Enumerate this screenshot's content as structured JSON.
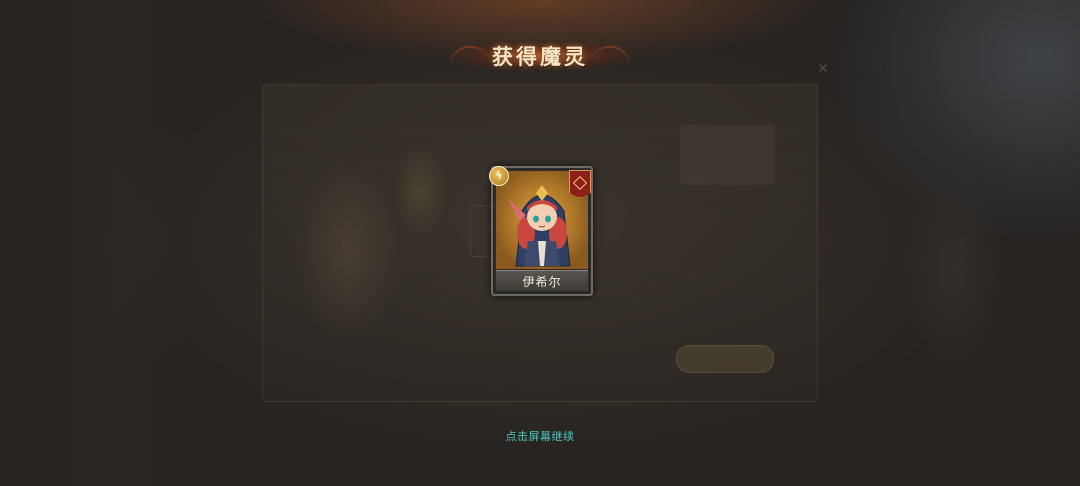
{
  "screen": {
    "title": "获得魔灵",
    "continue_hint": "点击屏幕继续"
  },
  "card": {
    "name": "伊希尔",
    "element_icon": "lightning-icon",
    "class_icon": "diamond-rune-icon",
    "element_color": "#e0a840",
    "class_color": "#8e1f1a"
  },
  "colors": {
    "title": "#f7e4c2",
    "hint": "#4fc7c1",
    "banner": "#be501e"
  }
}
